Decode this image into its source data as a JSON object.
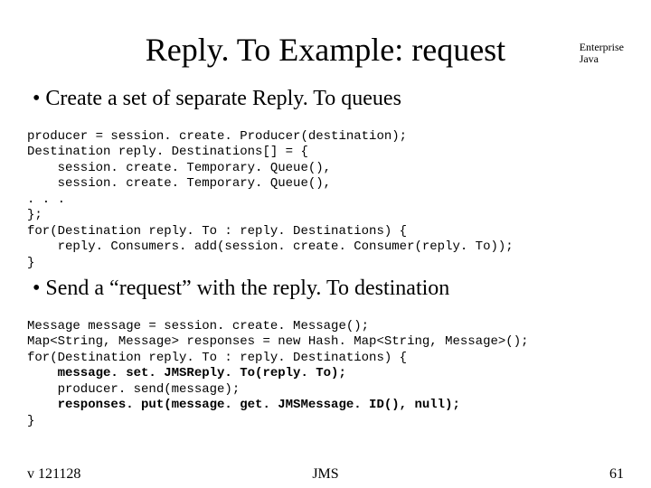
{
  "corner": "Enterprise\nJava",
  "title": "Reply. To Example: request",
  "bullets": {
    "b1": "Create a set of separate Reply. To queues",
    "b2": "Send a “request” with the reply. To destination"
  },
  "code": {
    "c1_l1": "producer = session. create. Producer(destination);",
    "c1_l2": "Destination reply. Destinations[] = {",
    "c1_l3": "    session. create. Temporary. Queue(),",
    "c1_l4": "    session. create. Temporary. Queue(),",
    "c1_l5": ". . .",
    "c1_l6": "};",
    "c1_l7": "for(Destination reply. To : reply. Destinations) {",
    "c1_l8": "    reply. Consumers. add(session. create. Consumer(reply. To));",
    "c1_l9": "}",
    "c2_l1": "Message message = session. create. Message();",
    "c2_l2": "Map<String, Message> responses = new Hash. Map<String, Message>();",
    "c2_l3": "for(Destination reply. To : reply. Destinations) {",
    "c2_l4": "    message. set. JMSReply. To(reply. To);",
    "c2_l5": "    producer. send(message);",
    "c2_l6": "    responses. put(message. get. JMSMessage. ID(), null);",
    "c2_l7": "}"
  },
  "footer": {
    "left": "v 121128",
    "center": "JMS",
    "right": "61"
  }
}
